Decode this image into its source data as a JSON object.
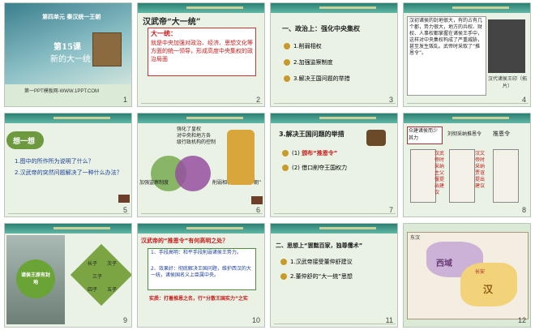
{
  "slides": [
    {
      "number": "1",
      "unit": "第四单元 秦汉统一王朝",
      "lesson": "第15课",
      "title": "新的大一统",
      "watermark": "第一PPT模板网-WWW.1PPT.COM"
    },
    {
      "number": "2",
      "title": "汉武帝“大一统”",
      "box_title": "大一统：",
      "box_text": "就是中央加强对政治、经济、思想文化等方面的统一领导，形成高度中央集权的政治局面"
    },
    {
      "number": "3",
      "heading": "一、政治上：强化中央集权",
      "items": [
        "1.削弱相权",
        "2.加强监察制度",
        "3.解决王国问题的举措"
      ]
    },
    {
      "number": "4",
      "panel_text": "汉初诸侯的封地很大，有的占有几个郡，势力很大，地方的兵权、财权、人事权都掌握在诸侯王手中，这样对中央集权构成了严重威胁，甚至发生叛乱。武帝时采取了“推恩令”。",
      "caption": "汉代诸侯王印（拓片）"
    },
    {
      "number": "5",
      "tag": "想一想",
      "q1": "1.图中的所作所为说明了什么？",
      "q2": "2.汉武帝的突然问题解决了一种什么办法？"
    },
    {
      "number": "6",
      "label_top": "强化了皇权\n对中央和地方各\n级行政机构的控制",
      "label_left": "加强监察制度",
      "label_right": "削弱相权，设立“中朝”"
    },
    {
      "number": "7",
      "heading": "3.解决王国问题的举措",
      "item1_prefix": "(1)",
      "item1": "颁布“推恩令”",
      "item2_prefix": "(2)",
      "item2": "借口削夺王国权力"
    },
    {
      "number": "8",
      "left": "主父偃",
      "left2": "众建诸侯而少其力",
      "mid": "刘彻采纳推恩令",
      "right": "推恩令",
      "sub1": "汉武帝时采纳主父偃提出建议",
      "sub2": "汉文帝时采纳贾谊提出建议"
    },
    {
      "number": "9",
      "center": "诸侯王原有封地",
      "cells": [
        "长子",
        "次子",
        "三子",
        "四子",
        "五子"
      ]
    },
    {
      "number": "10",
      "title": "汉武帝的“推恩令”有何高明之处？",
      "p1": "1、手段高明：和平手段削弱诸侯王势力。",
      "p2": "2、效果好：彻底解决王国问题，维护西汉的大一统，诸侯国名义上臣属中央。",
      "p3": "实质：打着推恩之名，行“分散王国实力”之实"
    },
    {
      "number": "11",
      "heading": "二、思想上“罢黜百家，独尊儒术”",
      "items": [
        "1.汉武帝接受董仲舒建议",
        "2.董仲舒的“大一统”思想"
      ]
    },
    {
      "number": "12",
      "map_labels": [
        "东汉",
        "西域",
        "长安",
        "汉"
      ]
    }
  ]
}
